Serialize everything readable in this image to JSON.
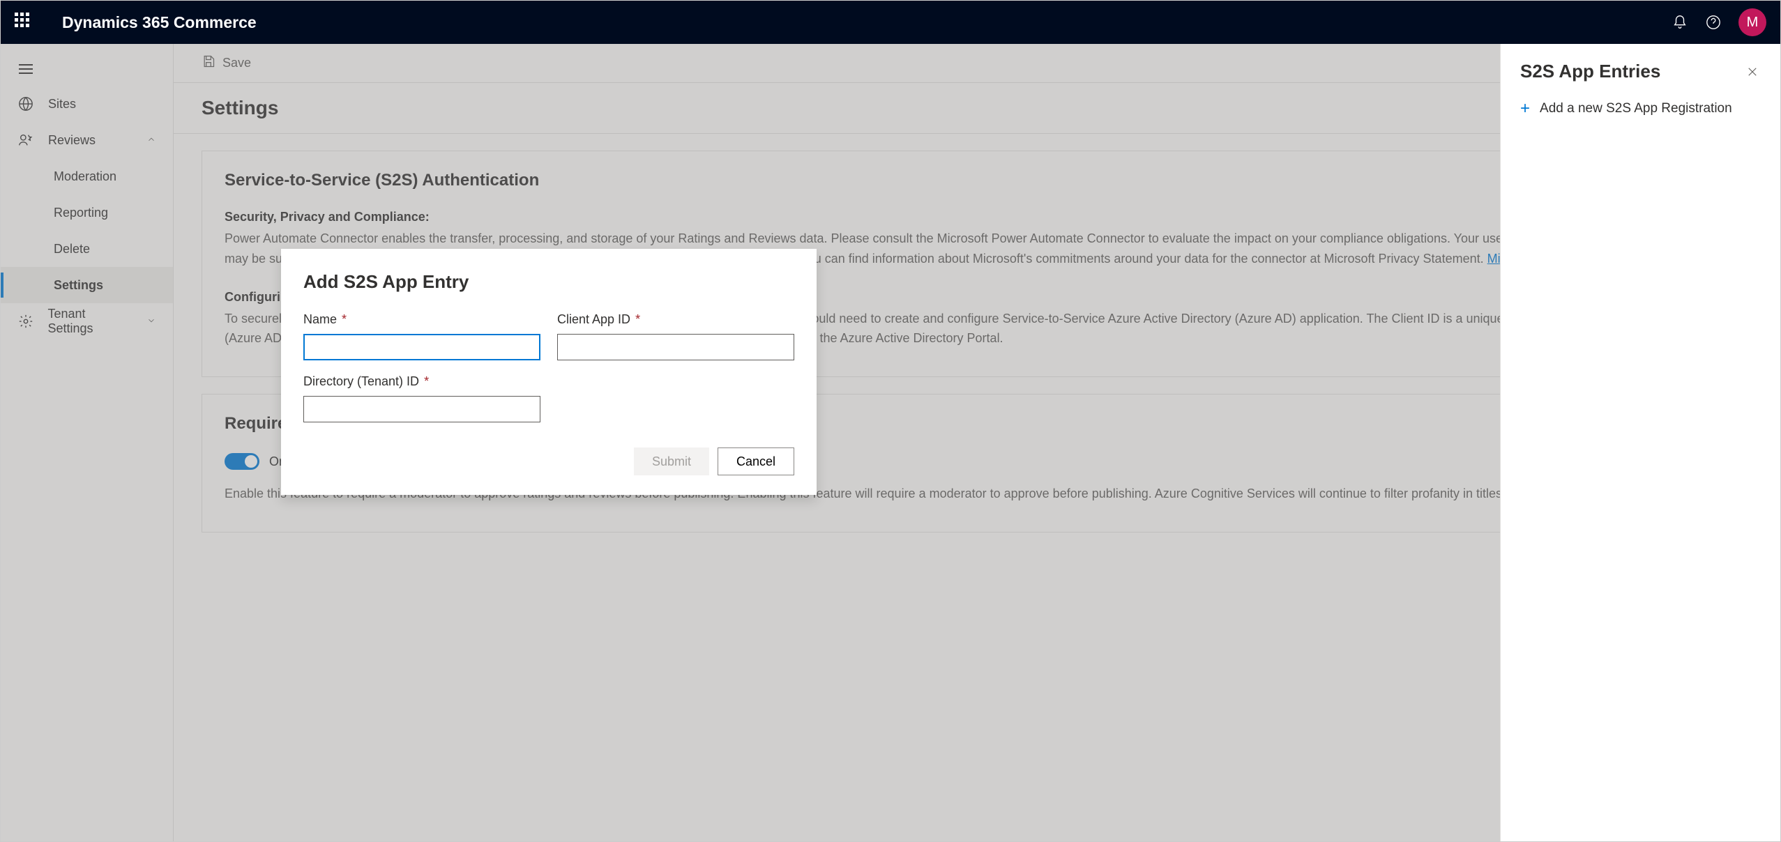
{
  "header": {
    "app_title": "Dynamics 365 Commerce",
    "avatar_initial": "M"
  },
  "sidebar": {
    "items": [
      {
        "label": "Sites"
      },
      {
        "label": "Reviews"
      },
      {
        "label": "Moderation"
      },
      {
        "label": "Reporting"
      },
      {
        "label": "Delete"
      },
      {
        "label": "Settings"
      },
      {
        "label": "Tenant Settings"
      }
    ]
  },
  "toolbar": {
    "save_label": "Save"
  },
  "page": {
    "title": "Settings"
  },
  "s2s_card": {
    "title": "Service-to-Service (S2S) Authentication",
    "security_heading": "Security, Privacy and Compliance:",
    "security_text": "Power Automate Connector enables the transfer, processing, and storage of your Ratings and Reviews data. Please consult the Microsoft Power Automate Connector to evaluate the impact on your compliance obligations. Your use of Microsoft Power Automate connector may be subject to a different security, compliance geography or commitment and privacy commitments. You can find information about Microsoft's commitments around your data for the connector at Microsoft Privacy Statement. ",
    "privacy_link": "Microsoft Privacy Statement",
    "config_heading": "Configuring Service-to-service Application:",
    "config_text": "To securely access ratings and reviews service APIs such as Microsoft Power Automate Connector, you would need to create and configure Service-to-Service Azure Active Directory (Azure AD) application. The Client ID is a unique identifier that Azure Active Directory (Azure AD) assigns to your application. You can find the Client ID assigned by the Azure Active Directory in the Azure Active Directory Portal."
  },
  "moderator_card": {
    "title": "Require moderator for ratings and reviews",
    "toggle_label": "On",
    "description": "Enable this feature to require a moderator to approve ratings and reviews before publishing. Enabling this feature will require a moderator to approve before publishing. Azure Cognitive Services will continue to filter profanity in titles and content."
  },
  "right_panel": {
    "title": "S2S App Entries",
    "add_action": "Add a new S2S App Registration"
  },
  "modal": {
    "title": "Add S2S App Entry",
    "name_label": "Name",
    "client_label": "Client App ID",
    "tenant_label": "Directory (Tenant) ID",
    "name_value": "",
    "client_value": "",
    "tenant_value": "",
    "submit_label": "Submit",
    "cancel_label": "Cancel"
  }
}
